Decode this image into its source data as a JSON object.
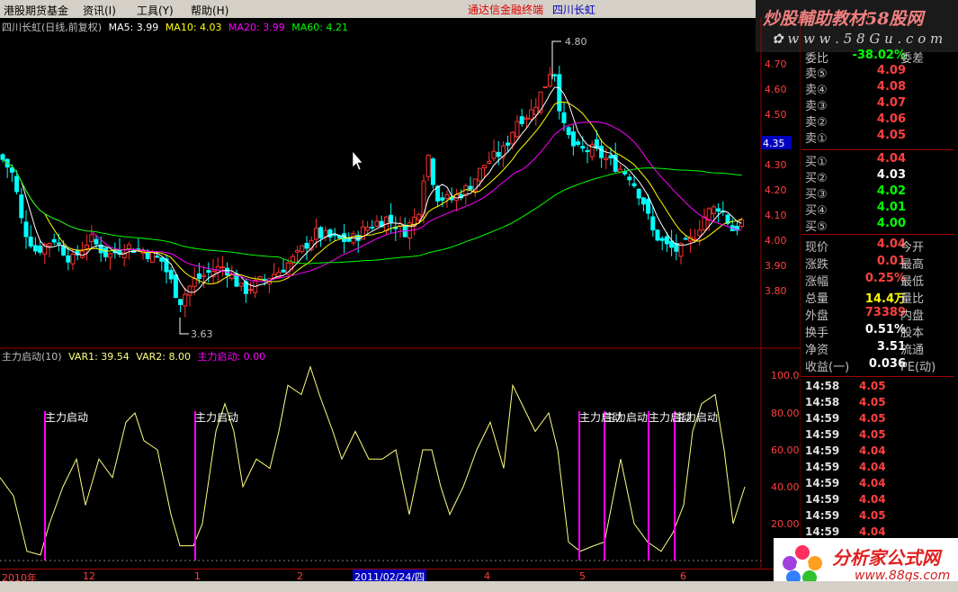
{
  "menu": {
    "items": [
      "港股期货基金",
      "资讯(I)",
      "工具(Y)",
      "帮助(H)"
    ],
    "center_text": "通达信金融终端",
    "stock_name": "四川长虹"
  },
  "brand": {
    "line1": "炒股輔助教材58股网",
    "line2": "✿ w w w . 5 8 G u . c o m"
  },
  "main_chart": {
    "header": {
      "name": "四川长虹(日线,前复权)",
      "ma5": "MA5: 3.99",
      "ma10": "MA10: 4.03",
      "ma20": "MA20: 3.99",
      "ma60": "MA60: 4.21"
    },
    "price_ticks": [
      "4.70",
      "4.60",
      "4.50",
      "4.40",
      "4.30",
      "4.20",
      "4.10",
      "4.00",
      "3.90",
      "3.80"
    ],
    "current_price_tag": "4.35",
    "high_label": "4.80",
    "low_label": "3.63"
  },
  "indicator_chart": {
    "header": {
      "name": "主力启动(10)",
      "var1": "VAR1: 39.54",
      "var2": "VAR2: 8.00",
      "signal": "主力启动: 0.00"
    },
    "ticks": [
      "100.0",
      "80.00",
      "60.00",
      "40.00",
      "20.00"
    ],
    "signal_label": "主力启动"
  },
  "time_axis": {
    "labels": [
      "2010年",
      "12",
      "1",
      "2",
      "3",
      "4",
      "5",
      "6"
    ],
    "highlight_date": "2011/02/24/四"
  },
  "order_book": {
    "top_row": {
      "label": "委比",
      "value": "-38.02%",
      "label2": "委差"
    },
    "sells": [
      {
        "label": "卖⑤",
        "price": "4.09"
      },
      {
        "label": "卖④",
        "price": "4.08"
      },
      {
        "label": "卖③",
        "price": "4.07"
      },
      {
        "label": "卖②",
        "price": "4.06"
      },
      {
        "label": "卖①",
        "price": "4.05"
      }
    ],
    "buys": [
      {
        "label": "买①",
        "price": "4.04"
      },
      {
        "label": "买②",
        "price": "4.03"
      },
      {
        "label": "买③",
        "price": "4.02"
      },
      {
        "label": "买④",
        "price": "4.01"
      },
      {
        "label": "买⑤",
        "price": "4.00"
      }
    ]
  },
  "quote": [
    {
      "label": "现价",
      "value": "4.04",
      "label2": "今开"
    },
    {
      "label": "涨跌",
      "value": "0.01",
      "label2": "最高"
    },
    {
      "label": "涨幅",
      "value": "0.25%",
      "label2": "最低"
    },
    {
      "label": "总量",
      "value": "14.4万",
      "label2": "量比"
    },
    {
      "label": "外盘",
      "value": "73389",
      "label2": "内盘"
    },
    {
      "label": "换手",
      "value": "0.51%",
      "label2": "股本"
    },
    {
      "label": "净资",
      "value": "3.51",
      "label2": "流通"
    },
    {
      "label": "收益(一)",
      "value": "0.036",
      "label2": "PE(动)"
    }
  ],
  "ticks": [
    {
      "time": "14:58",
      "price": "4.05"
    },
    {
      "time": "14:58",
      "price": "4.05"
    },
    {
      "time": "14:59",
      "price": "4.05"
    },
    {
      "time": "14:59",
      "price": "4.05"
    },
    {
      "time": "14:59",
      "price": "4.04"
    },
    {
      "time": "14:59",
      "price": "4.04"
    },
    {
      "time": "14:59",
      "price": "4.04"
    },
    {
      "time": "14:59",
      "price": "4.04"
    },
    {
      "time": "14:59",
      "price": "4.05"
    },
    {
      "time": "14:59",
      "price": "4.04"
    }
  ],
  "logo": {
    "line1": "分析家公式网",
    "line2": "www.88gs.com"
  },
  "colors": {
    "up": "#ff3030",
    "down": "#00ffff",
    "ma5": "#ffffff",
    "ma10": "#ffff00",
    "ma20": "#ff00ff",
    "ma60": "#00ff00",
    "signal": "#ff00ff",
    "var": "#ffff80"
  },
  "chart_data": [
    {
      "type": "candlestick",
      "title": "四川长虹(日线,前复权)",
      "series": [
        {
          "name": "MA5"
        },
        {
          "name": "MA10"
        },
        {
          "name": "MA20"
        },
        {
          "name": "MA60"
        }
      ],
      "ylim": [
        3.6,
        4.85
      ]
    },
    {
      "type": "line",
      "title": "主力启动(10)",
      "series": [
        {
          "name": "VAR1"
        },
        {
          "name": "VAR2"
        },
        {
          "name": "主力启动"
        }
      ],
      "ylim": [
        0,
        110
      ]
    }
  ]
}
